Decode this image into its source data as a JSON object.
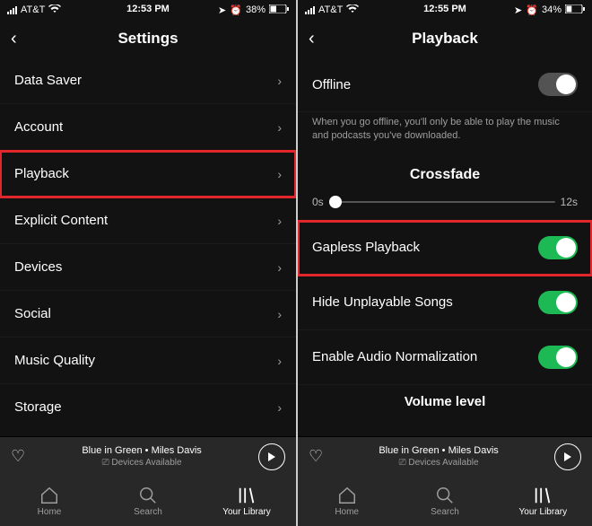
{
  "left": {
    "status": {
      "carrier": "AT&T",
      "time": "12:53 PM",
      "battery": "38%"
    },
    "title": "Settings",
    "rows": [
      {
        "label": "Data Saver"
      },
      {
        "label": "Account"
      },
      {
        "label": "Playback",
        "highlight": true
      },
      {
        "label": "Explicit Content"
      },
      {
        "label": "Devices"
      },
      {
        "label": "Social"
      },
      {
        "label": "Music Quality"
      },
      {
        "label": "Storage"
      }
    ]
  },
  "right": {
    "status": {
      "carrier": "AT&T",
      "time": "12:55 PM",
      "battery": "34%"
    },
    "title": "Playback",
    "offline_label": "Offline",
    "offline_help": "When you go offline, you'll only be able to play the music and podcasts you've downloaded.",
    "crossfade_label": "Crossfade",
    "cross_min": "0s",
    "cross_max": "12s",
    "toggles": [
      {
        "label": "Gapless Playback",
        "on": true,
        "highlight": true
      },
      {
        "label": "Hide Unplayable Songs",
        "on": true
      },
      {
        "label": "Enable Audio Normalization",
        "on": true
      }
    ],
    "volume_label": "Volume level"
  },
  "now_playing": {
    "track": "Blue in Green",
    "artist": "Miles Davis",
    "devices": "Devices Available"
  },
  "tabs": {
    "home": "Home",
    "search": "Search",
    "library": "Your Library"
  }
}
